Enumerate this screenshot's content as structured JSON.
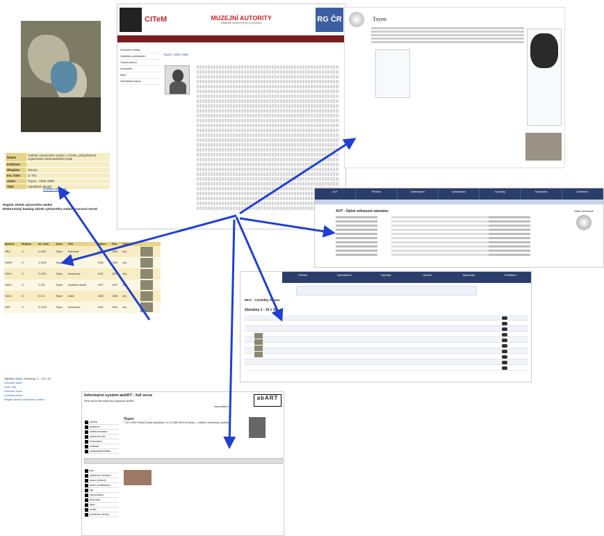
{
  "museum": {
    "labels": [
      "Název",
      "Instituce",
      "Skupina",
      "Inv. číslo",
      "Autor",
      "Titul"
    ],
    "values": [
      "Galerie výtvarného umění v Chebu, příspěvková organizace Karlovarského kraje",
      "",
      "obrazy",
      "O 781",
      "Toyen , 1902-1980",
      "Opuštěné doupě"
    ],
    "enlarge_label": "Zvětšit obrázek"
  },
  "catalogue": {
    "title": "Registr sbírek výtvarného umění",
    "subtitle": "Elektronický katalog sbírek výtvarného umění /pracovní verze/",
    "columns": [
      "Správce",
      "Skupina",
      "Inv. číslo",
      "Autor",
      "Titul",
      "Datace",
      "Rok",
      "Rok",
      "Technika"
    ],
    "rows": [
      [
        "GBU",
        "O",
        "K-2632",
        "Toyen",
        "Harmonie",
        "1928",
        "1928",
        "olej"
      ],
      [
        "GHMP",
        "O",
        "O 2045",
        "Toyen",
        "Pláž",
        "1928",
        "1928",
        "olej"
      ],
      [
        "GAVU",
        "O",
        "O 1103",
        "Toyen",
        "Kompozice",
        "1931",
        "1931",
        "olej"
      ],
      [
        "GAVU",
        "O",
        "O 115",
        "Toyen",
        "Opuštěné doupě",
        "1937",
        "1937",
        "olej"
      ],
      [
        "GAVU",
        "O",
        "O 412",
        "Toyen",
        "Zátiší",
        "1938",
        "1938",
        "olej"
      ],
      [
        "NGP",
        "O",
        "O 1218",
        "Toyen",
        "Kompozice",
        "1944",
        "1944",
        "olej"
      ]
    ],
    "footer": "Tabulka: Sloty | Seznamy: 1 – 15 z 15",
    "links": [
      "Zobrazit název",
      "Autor díla",
      "Zobrazit obraz",
      "Zobrazit sbírku",
      "Registr sbírek výtvarného umění"
    ]
  },
  "authority": {
    "citem": "CITeM",
    "title": "MUZEJNÍ AUTORITY",
    "subtitle": "Databáze osobních jmen a korporací",
    "rgc": "RG ČR",
    "sidebar": [
      "Souhrnné dotazy",
      "Výsledky vyhledávání",
      "Osobní jména",
      "Korporace",
      "Akce",
      "Zeměpisné názvy"
    ],
    "record_head": "Toyen, 1902-1980"
  },
  "wiki": {
    "title": "Toyen"
  },
  "aut": {
    "menu": [
      "AUT",
      "Přehled",
      "Vyhledávání",
      "Vyhledávání",
      "Výsledky",
      "Nápověda",
      "Odhlášení"
    ],
    "title": "AUT - Úplné zobrazení záznamu",
    "wiki_label": "Další informace"
  },
  "mcc": {
    "logo": "NK",
    "menu": [
      "Přehled",
      "Vyhledávání",
      "Výsledky",
      "Historie",
      "Nápověda",
      "Odhlášení"
    ],
    "title": "MCC - Výsledky dotazu",
    "count": "Záznamy 1 - 10 z 30"
  },
  "abart": {
    "title": "Informační systém abART - full verze",
    "subtitle": "Plná verze informačního systému abART",
    "url": "www.artlib.cz",
    "logo": "abART",
    "menu": [
      "osoba",
      "skupina",
      "instituce/místo",
      "výtvarné dílo",
      "dokument",
      "událost",
      "událost/přehlídka"
    ],
    "name": "Toyen",
    "info": "* 21.9.1902 Praha (Česká republika) † 9.11.1980 Paříž (Francie) – malířka, ilustrátorka, grafička",
    "menu2": [
      "dílo",
      "výtvarné médium",
      "autor (tvůrce)",
      "autor (publikace)",
      "typ",
      "reprodukce",
      "technika",
      "žánr",
      "místo",
      "evidence sbírky"
    ]
  },
  "colors": {
    "arrow": "#1f3fd1",
    "museum_accent": "#e6d489",
    "authority_red": "#c0272d"
  }
}
